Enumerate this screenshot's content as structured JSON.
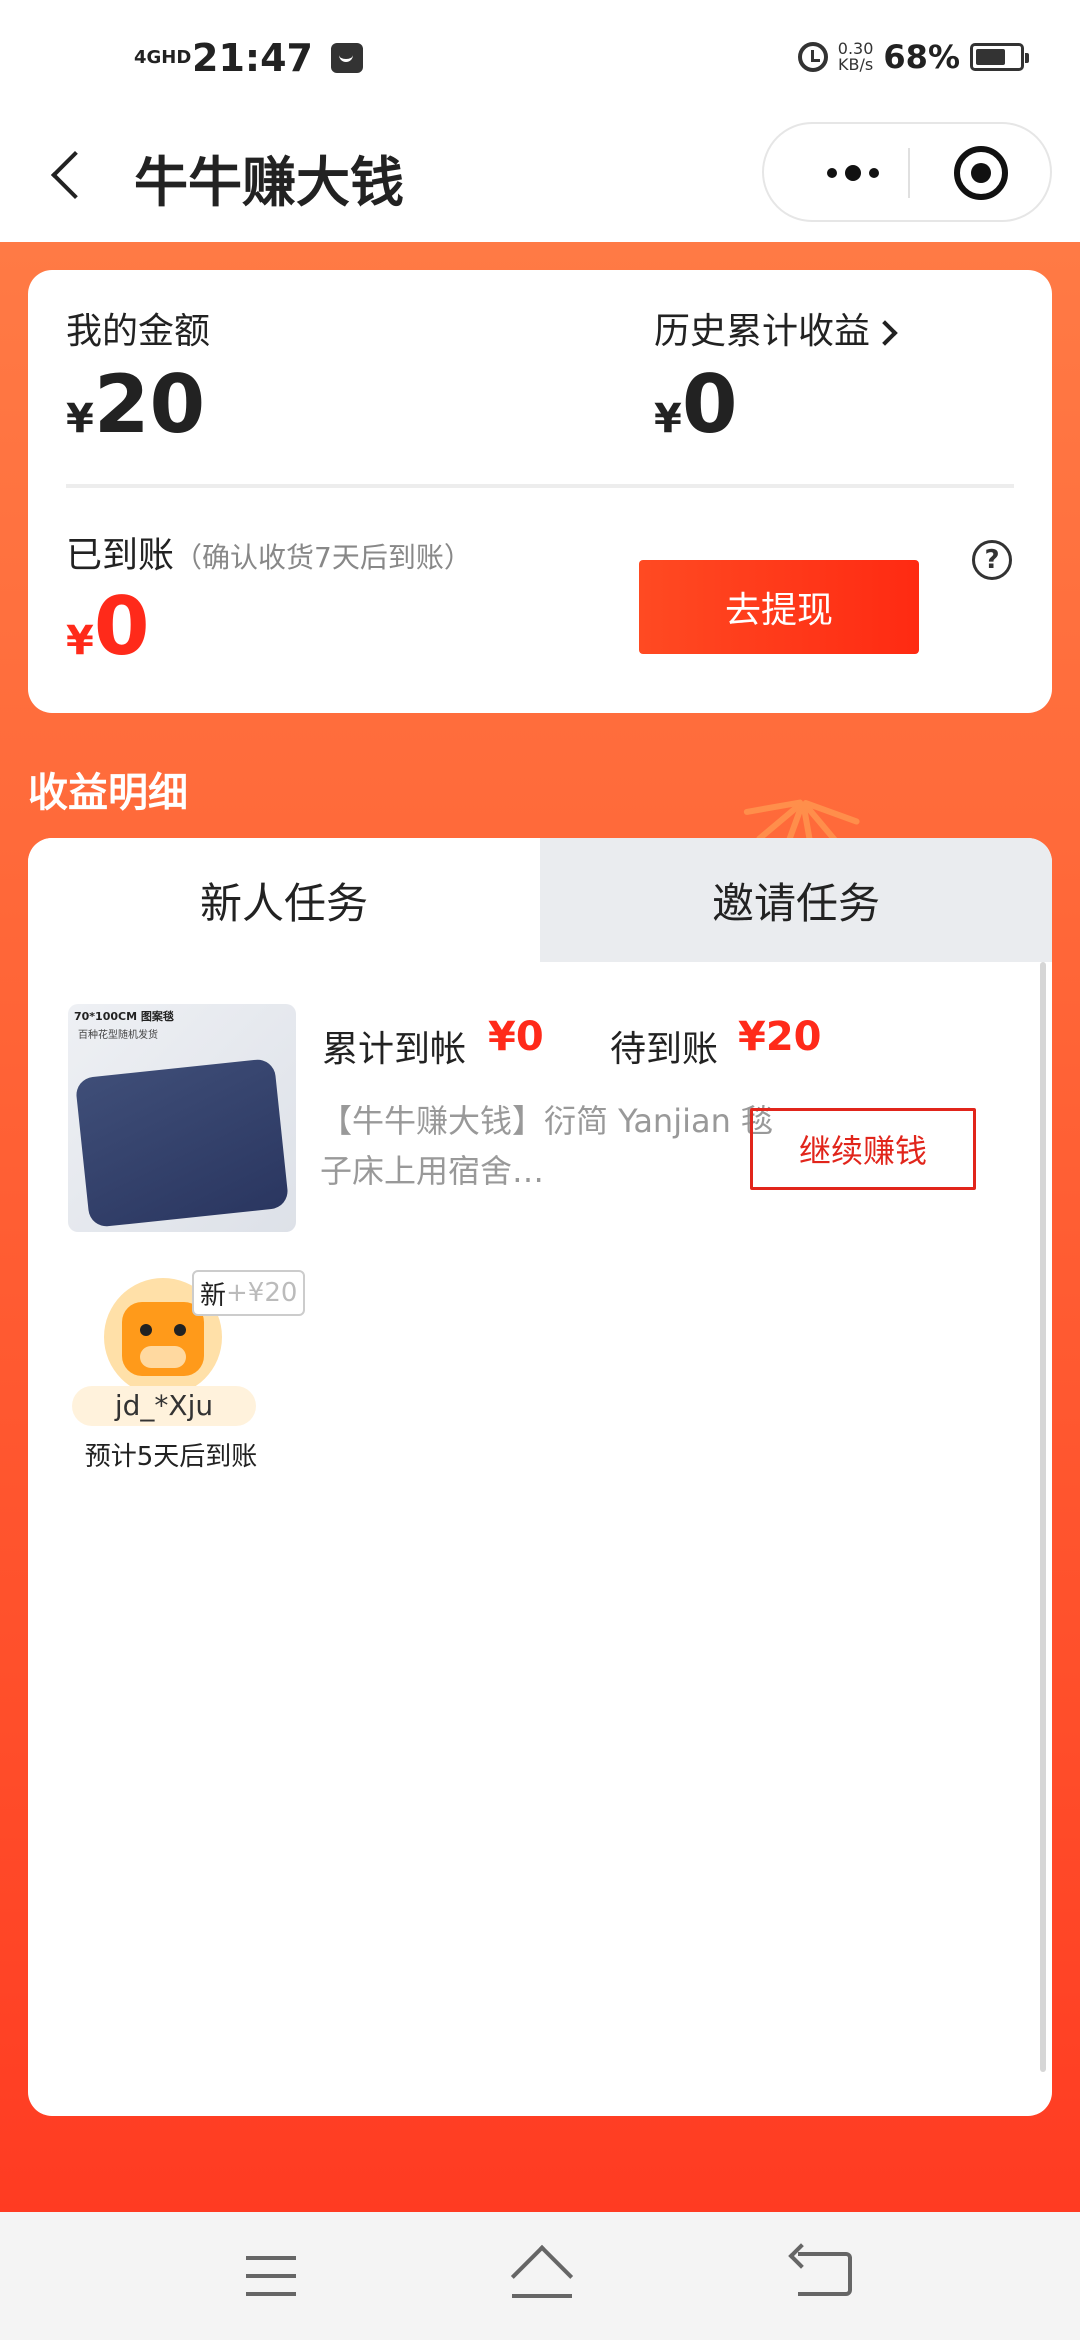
{
  "status_bar": {
    "network": "4GHD",
    "time": "21:47",
    "speed_value": "0.30",
    "speed_unit": "KB/s",
    "battery_pct": "68%",
    "battery_level": 0.68,
    "icons": [
      "signal-icon",
      "message-icon",
      "alarm-icon",
      "battery-icon"
    ]
  },
  "header": {
    "title": "牛牛赚大钱",
    "back_icon": "back-arrow-icon",
    "more_icon": "more-dots-icon",
    "close_icon": "target-close-icon"
  },
  "balance_card": {
    "my_amount_label": "我的金额",
    "currency": "¥",
    "my_amount": "20",
    "history_label": "历史累计收益",
    "history_amount": "0",
    "arrived_label": "已到账",
    "arrived_note": "（确认收货7天后到账）",
    "arrived_amount": "0",
    "withdraw_button": "去提现",
    "help_icon": "question-circle-icon",
    "help_glyph": "?"
  },
  "details": {
    "section_title": "收益明细",
    "tabs": [
      {
        "label": "新人任务",
        "active": true
      },
      {
        "label": "邀请任务",
        "active": false
      }
    ],
    "product": {
      "image_caption_1": "70*100CM 图案毯",
      "image_caption_2": "百种花型随机发货",
      "accumulated_label": "累计到帐",
      "accumulated_value": "¥0",
      "pending_label": "待到账",
      "pending_value": "¥20",
      "description": "【牛牛赚大钱】衍简 Yanjian 毯子床上用宿舍…",
      "continue_button": "继续赚钱"
    },
    "invitee": {
      "badge_new": "新",
      "badge_amount": "+¥20",
      "username": "jd_*Xju",
      "arrival_note": "预计5天后到账"
    }
  },
  "nav_bar": {
    "icons": [
      "menu-icon",
      "home-icon",
      "back-icon"
    ]
  },
  "colors": {
    "accent_red": "#ff2a1a",
    "button_border_red": "#e1251b",
    "bg_orange_top": "#ff7a45",
    "bg_orange_bottom": "#ff3b22"
  }
}
